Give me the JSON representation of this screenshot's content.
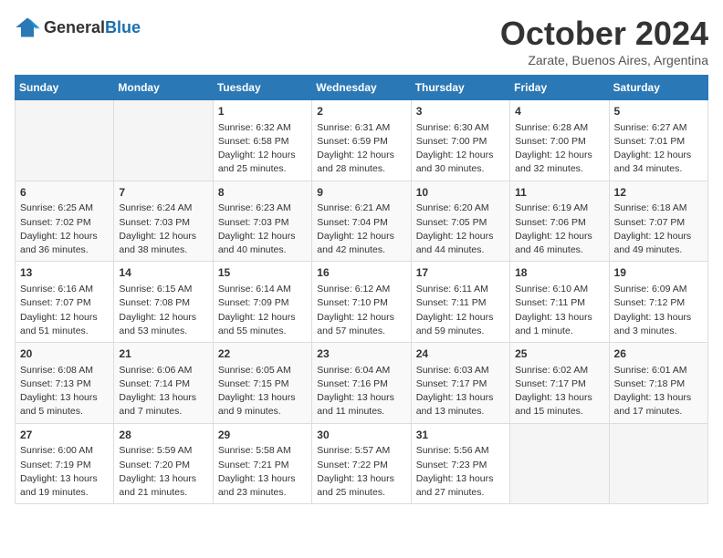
{
  "logo": {
    "general": "General",
    "blue": "Blue"
  },
  "title": "October 2024",
  "location": "Zarate, Buenos Aires, Argentina",
  "weekdays": [
    "Sunday",
    "Monday",
    "Tuesday",
    "Wednesday",
    "Thursday",
    "Friday",
    "Saturday"
  ],
  "weeks": [
    [
      {
        "day": "",
        "info": ""
      },
      {
        "day": "",
        "info": ""
      },
      {
        "day": "1",
        "info": "Sunrise: 6:32 AM\nSunset: 6:58 PM\nDaylight: 12 hours and 25 minutes."
      },
      {
        "day": "2",
        "info": "Sunrise: 6:31 AM\nSunset: 6:59 PM\nDaylight: 12 hours and 28 minutes."
      },
      {
        "day": "3",
        "info": "Sunrise: 6:30 AM\nSunset: 7:00 PM\nDaylight: 12 hours and 30 minutes."
      },
      {
        "day": "4",
        "info": "Sunrise: 6:28 AM\nSunset: 7:00 PM\nDaylight: 12 hours and 32 minutes."
      },
      {
        "day": "5",
        "info": "Sunrise: 6:27 AM\nSunset: 7:01 PM\nDaylight: 12 hours and 34 minutes."
      }
    ],
    [
      {
        "day": "6",
        "info": "Sunrise: 6:25 AM\nSunset: 7:02 PM\nDaylight: 12 hours and 36 minutes."
      },
      {
        "day": "7",
        "info": "Sunrise: 6:24 AM\nSunset: 7:03 PM\nDaylight: 12 hours and 38 minutes."
      },
      {
        "day": "8",
        "info": "Sunrise: 6:23 AM\nSunset: 7:03 PM\nDaylight: 12 hours and 40 minutes."
      },
      {
        "day": "9",
        "info": "Sunrise: 6:21 AM\nSunset: 7:04 PM\nDaylight: 12 hours and 42 minutes."
      },
      {
        "day": "10",
        "info": "Sunrise: 6:20 AM\nSunset: 7:05 PM\nDaylight: 12 hours and 44 minutes."
      },
      {
        "day": "11",
        "info": "Sunrise: 6:19 AM\nSunset: 7:06 PM\nDaylight: 12 hours and 46 minutes."
      },
      {
        "day": "12",
        "info": "Sunrise: 6:18 AM\nSunset: 7:07 PM\nDaylight: 12 hours and 49 minutes."
      }
    ],
    [
      {
        "day": "13",
        "info": "Sunrise: 6:16 AM\nSunset: 7:07 PM\nDaylight: 12 hours and 51 minutes."
      },
      {
        "day": "14",
        "info": "Sunrise: 6:15 AM\nSunset: 7:08 PM\nDaylight: 12 hours and 53 minutes."
      },
      {
        "day": "15",
        "info": "Sunrise: 6:14 AM\nSunset: 7:09 PM\nDaylight: 12 hours and 55 minutes."
      },
      {
        "day": "16",
        "info": "Sunrise: 6:12 AM\nSunset: 7:10 PM\nDaylight: 12 hours and 57 minutes."
      },
      {
        "day": "17",
        "info": "Sunrise: 6:11 AM\nSunset: 7:11 PM\nDaylight: 12 hours and 59 minutes."
      },
      {
        "day": "18",
        "info": "Sunrise: 6:10 AM\nSunset: 7:11 PM\nDaylight: 13 hours and 1 minute."
      },
      {
        "day": "19",
        "info": "Sunrise: 6:09 AM\nSunset: 7:12 PM\nDaylight: 13 hours and 3 minutes."
      }
    ],
    [
      {
        "day": "20",
        "info": "Sunrise: 6:08 AM\nSunset: 7:13 PM\nDaylight: 13 hours and 5 minutes."
      },
      {
        "day": "21",
        "info": "Sunrise: 6:06 AM\nSunset: 7:14 PM\nDaylight: 13 hours and 7 minutes."
      },
      {
        "day": "22",
        "info": "Sunrise: 6:05 AM\nSunset: 7:15 PM\nDaylight: 13 hours and 9 minutes."
      },
      {
        "day": "23",
        "info": "Sunrise: 6:04 AM\nSunset: 7:16 PM\nDaylight: 13 hours and 11 minutes."
      },
      {
        "day": "24",
        "info": "Sunrise: 6:03 AM\nSunset: 7:17 PM\nDaylight: 13 hours and 13 minutes."
      },
      {
        "day": "25",
        "info": "Sunrise: 6:02 AM\nSunset: 7:17 PM\nDaylight: 13 hours and 15 minutes."
      },
      {
        "day": "26",
        "info": "Sunrise: 6:01 AM\nSunset: 7:18 PM\nDaylight: 13 hours and 17 minutes."
      }
    ],
    [
      {
        "day": "27",
        "info": "Sunrise: 6:00 AM\nSunset: 7:19 PM\nDaylight: 13 hours and 19 minutes."
      },
      {
        "day": "28",
        "info": "Sunrise: 5:59 AM\nSunset: 7:20 PM\nDaylight: 13 hours and 21 minutes."
      },
      {
        "day": "29",
        "info": "Sunrise: 5:58 AM\nSunset: 7:21 PM\nDaylight: 13 hours and 23 minutes."
      },
      {
        "day": "30",
        "info": "Sunrise: 5:57 AM\nSunset: 7:22 PM\nDaylight: 13 hours and 25 minutes."
      },
      {
        "day": "31",
        "info": "Sunrise: 5:56 AM\nSunset: 7:23 PM\nDaylight: 13 hours and 27 minutes."
      },
      {
        "day": "",
        "info": ""
      },
      {
        "day": "",
        "info": ""
      }
    ]
  ]
}
